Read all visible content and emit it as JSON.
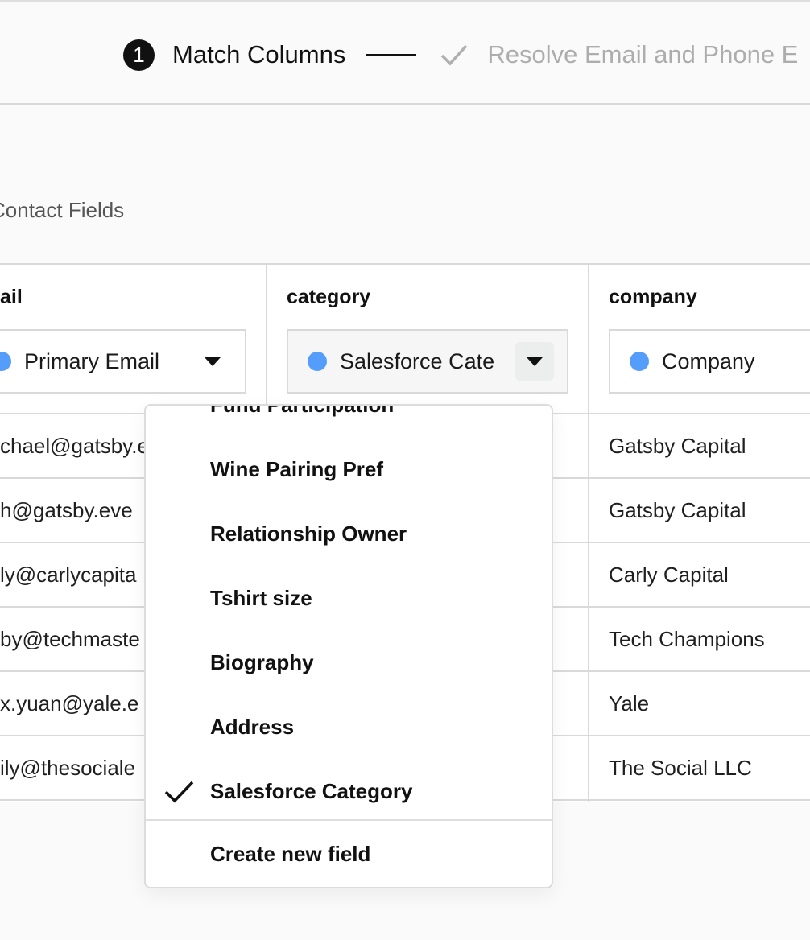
{
  "stepper": {
    "steps": [
      {
        "number": "1",
        "label": "Match Columns",
        "state": "active"
      },
      {
        "label": "Resolve Email and Phone E",
        "state": "upcoming"
      }
    ]
  },
  "section": {
    "title": "Contact Fields"
  },
  "colors": {
    "accent_dot": "#559dfa",
    "inactive_text": "#adadad",
    "border": "#d9d9d9"
  },
  "table": {
    "columns": [
      {
        "title": "ail",
        "mapping": "Primary Email",
        "cells": [
          "chael@gatsby.e",
          "h@gatsby.eve",
          "ly@carlycapita",
          "by@techmaste",
          "x.yuan@yale.e",
          "ily@thesociale"
        ]
      },
      {
        "title": "category",
        "mapping": "Salesforce Cate",
        "cells": [
          "",
          "",
          "",
          "",
          "",
          ""
        ]
      },
      {
        "title": "company",
        "mapping": "Company",
        "cells": [
          "Gatsby Capital",
          "Gatsby Capital",
          "Carly Capital",
          "Tech Champions",
          "Yale",
          "The Social LLC"
        ]
      }
    ]
  },
  "dropdown": {
    "items": [
      {
        "label": "Fund Participation",
        "selected": false
      },
      {
        "label": "Wine Pairing Pref",
        "selected": false
      },
      {
        "label": "Relationship Owner",
        "selected": false
      },
      {
        "label": "Tshirt size",
        "selected": false
      },
      {
        "label": "Biography",
        "selected": false
      },
      {
        "label": "Address",
        "selected": false
      },
      {
        "label": "Salesforce Category",
        "selected": true
      }
    ],
    "footer_action": "Create new field"
  }
}
